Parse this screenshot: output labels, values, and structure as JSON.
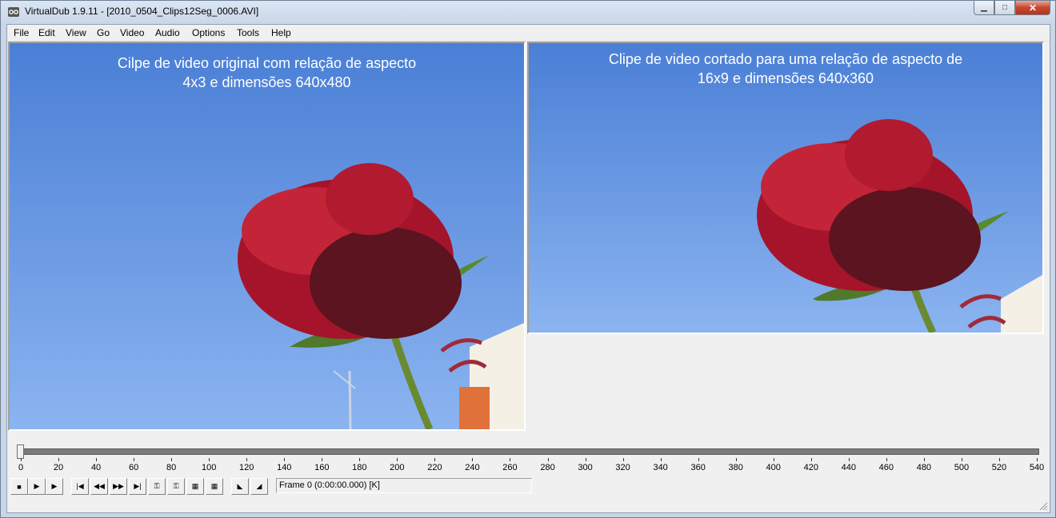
{
  "window": {
    "title": "VirtualDub 1.9.11 - [2010_0504_Clips12Seg_0006.AVI]",
    "minimize_glyph": "▁",
    "maximize_glyph": "□",
    "close_glyph": "✕"
  },
  "menu": [
    {
      "label": "File"
    },
    {
      "label": "Edit"
    },
    {
      "label": "View"
    },
    {
      "label": "Go"
    },
    {
      "label": "Video"
    },
    {
      "label": "Audio"
    },
    {
      "label": "Options"
    },
    {
      "label": "Tools"
    },
    {
      "label": "Help"
    }
  ],
  "panes": {
    "input": {
      "caption_line1": "Cilpe de video original com relação de aspecto",
      "caption_line2": "4x3 e dimensões 640x480"
    },
    "output": {
      "caption_line1": "Clipe de video cortado para uma relação de aspecto de",
      "caption_line2": "16x9 e dimensões 640x360"
    }
  },
  "timeline": {
    "position": 0,
    "max": 540,
    "ticks": [
      "0",
      "20",
      "40",
      "60",
      "80",
      "100",
      "120",
      "140",
      "160",
      "180",
      "200",
      "220",
      "240",
      "260",
      "280",
      "300",
      "320",
      "340",
      "360",
      "380",
      "400",
      "420",
      "440",
      "460",
      "480",
      "500",
      "520",
      "540"
    ]
  },
  "toolbar": {
    "buttons": [
      {
        "name": "stop-button",
        "glyph": "■"
      },
      {
        "name": "play-input-button",
        "glyph": "▶"
      },
      {
        "name": "play-output-button",
        "glyph": "▶"
      },
      {
        "name": "start-button",
        "glyph": "|◀"
      },
      {
        "name": "prev-frame-button",
        "glyph": "◀◀"
      },
      {
        "name": "next-frame-button",
        "glyph": "▶▶"
      },
      {
        "name": "end-button",
        "glyph": "▶|"
      },
      {
        "name": "prev-keyframe-button",
        "glyph": "⚿"
      },
      {
        "name": "next-keyframe-button",
        "glyph": "⚿"
      },
      {
        "name": "prev-scene-button",
        "glyph": "▦"
      },
      {
        "name": "next-scene-button",
        "glyph": "▦"
      },
      {
        "name": "mark-in-button",
        "glyph": "◣"
      },
      {
        "name": "mark-out-button",
        "glyph": "◢"
      }
    ],
    "frame_text": "Frame 0 (0:00:00.000) [K]"
  },
  "colors": {
    "sky": "#5b8ee0",
    "rose": "#b3182a",
    "stem": "#6c8a2f",
    "chrome": "#f0f0f0"
  }
}
